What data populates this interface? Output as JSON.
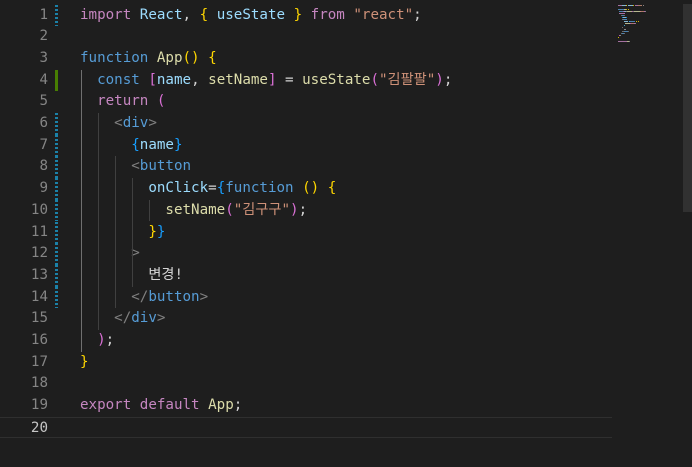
{
  "editor": {
    "active_line": "20",
    "lines": [
      {
        "n": "1",
        "tokens": [
          {
            "t": "import ",
            "c": "kw2"
          },
          {
            "t": "React",
            "c": "var"
          },
          {
            "t": ", ",
            "c": "txt"
          },
          {
            "t": "{",
            "c": "brk1"
          },
          {
            "t": " useState ",
            "c": "var"
          },
          {
            "t": "}",
            "c": "brk1"
          },
          {
            "t": " from ",
            "c": "kw2"
          },
          {
            "t": "\"react\"",
            "c": "str"
          },
          {
            "t": ";",
            "c": "txt"
          }
        ]
      },
      {
        "n": "2",
        "tokens": []
      },
      {
        "n": "3",
        "tokens": [
          {
            "t": "function ",
            "c": "kw"
          },
          {
            "t": "App",
            "c": "fn"
          },
          {
            "t": "()",
            "c": "brk1"
          },
          {
            "t": " ",
            "c": "txt"
          },
          {
            "t": "{",
            "c": "brk1"
          }
        ]
      },
      {
        "n": "4",
        "tokens": [
          {
            "t": "  const ",
            "c": "kw"
          },
          {
            "t": "[",
            "c": "brk2"
          },
          {
            "t": "name",
            "c": "var"
          },
          {
            "t": ", ",
            "c": "txt"
          },
          {
            "t": "setName",
            "c": "fn"
          },
          {
            "t": "]",
            "c": "brk2"
          },
          {
            "t": " = ",
            "c": "txt"
          },
          {
            "t": "useState",
            "c": "fn"
          },
          {
            "t": "(",
            "c": "brk2"
          },
          {
            "t": "\"김팔팔\"",
            "c": "str"
          },
          {
            "t": ")",
            "c": "brk2"
          },
          {
            "t": ";",
            "c": "txt"
          }
        ]
      },
      {
        "n": "5",
        "tokens": [
          {
            "t": "  return ",
            "c": "kw2"
          },
          {
            "t": "(",
            "c": "brk2"
          }
        ]
      },
      {
        "n": "6",
        "tokens": [
          {
            "t": "    ",
            "c": "txt"
          },
          {
            "t": "<",
            "c": "punct"
          },
          {
            "t": "div",
            "c": "tag"
          },
          {
            "t": ">",
            "c": "punct"
          }
        ]
      },
      {
        "n": "7",
        "tokens": [
          {
            "t": "      ",
            "c": "txt"
          },
          {
            "t": "{",
            "c": "brk3"
          },
          {
            "t": "name",
            "c": "var"
          },
          {
            "t": "}",
            "c": "brk3"
          }
        ]
      },
      {
        "n": "8",
        "tokens": [
          {
            "t": "      ",
            "c": "txt"
          },
          {
            "t": "<",
            "c": "punct"
          },
          {
            "t": "button",
            "c": "tag"
          }
        ]
      },
      {
        "n": "9",
        "tokens": [
          {
            "t": "        ",
            "c": "txt"
          },
          {
            "t": "onClick",
            "c": "var"
          },
          {
            "t": "=",
            "c": "txt"
          },
          {
            "t": "{",
            "c": "brk3"
          },
          {
            "t": "function ",
            "c": "kw"
          },
          {
            "t": "()",
            "c": "brk1"
          },
          {
            "t": " ",
            "c": "txt"
          },
          {
            "t": "{",
            "c": "brk1"
          }
        ]
      },
      {
        "n": "10",
        "tokens": [
          {
            "t": "          ",
            "c": "txt"
          },
          {
            "t": "setName",
            "c": "fn"
          },
          {
            "t": "(",
            "c": "brk2"
          },
          {
            "t": "\"김구구\"",
            "c": "str"
          },
          {
            "t": ")",
            "c": "brk2"
          },
          {
            "t": ";",
            "c": "txt"
          }
        ]
      },
      {
        "n": "11",
        "tokens": [
          {
            "t": "        ",
            "c": "txt"
          },
          {
            "t": "}",
            "c": "brk1"
          },
          {
            "t": "}",
            "c": "brk3"
          }
        ]
      },
      {
        "n": "12",
        "tokens": [
          {
            "t": "      ",
            "c": "txt"
          },
          {
            "t": ">",
            "c": "punct"
          }
        ]
      },
      {
        "n": "13",
        "tokens": [
          {
            "t": "        변경!",
            "c": "txt"
          }
        ]
      },
      {
        "n": "14",
        "tokens": [
          {
            "t": "      ",
            "c": "txt"
          },
          {
            "t": "</",
            "c": "punct"
          },
          {
            "t": "button",
            "c": "tag"
          },
          {
            "t": ">",
            "c": "punct"
          }
        ]
      },
      {
        "n": "15",
        "tokens": [
          {
            "t": "    ",
            "c": "txt"
          },
          {
            "t": "</",
            "c": "punct"
          },
          {
            "t": "div",
            "c": "tag"
          },
          {
            "t": ">",
            "c": "punct"
          }
        ]
      },
      {
        "n": "16",
        "tokens": [
          {
            "t": "  ",
            "c": "txt"
          },
          {
            "t": ")",
            "c": "brk2"
          },
          {
            "t": ";",
            "c": "txt"
          }
        ]
      },
      {
        "n": "17",
        "tokens": [
          {
            "t": "}",
            "c": "brk1"
          }
        ]
      },
      {
        "n": "18",
        "tokens": []
      },
      {
        "n": "19",
        "tokens": [
          {
            "t": "export ",
            "c": "kw2"
          },
          {
            "t": "default ",
            "c": "kw2"
          },
          {
            "t": "App",
            "c": "fn"
          },
          {
            "t": ";",
            "c": "txt"
          }
        ]
      },
      {
        "n": "20",
        "tokens": []
      }
    ],
    "git_gutter": {
      "modified": [
        "1",
        "6",
        "7",
        "8",
        "9",
        "10",
        "11",
        "12",
        "13",
        "14"
      ],
      "added": [
        "4"
      ]
    },
    "colors": {
      "background": "#1e1e1e",
      "keyword": "#569cd6",
      "control": "#c586c0",
      "function": "#dcdcaa",
      "variable": "#9cdcfe",
      "string": "#ce9178",
      "bracket_gold": "#ffd700",
      "bracket_orchid": "#da70d6",
      "bracket_blue": "#179fff"
    }
  }
}
